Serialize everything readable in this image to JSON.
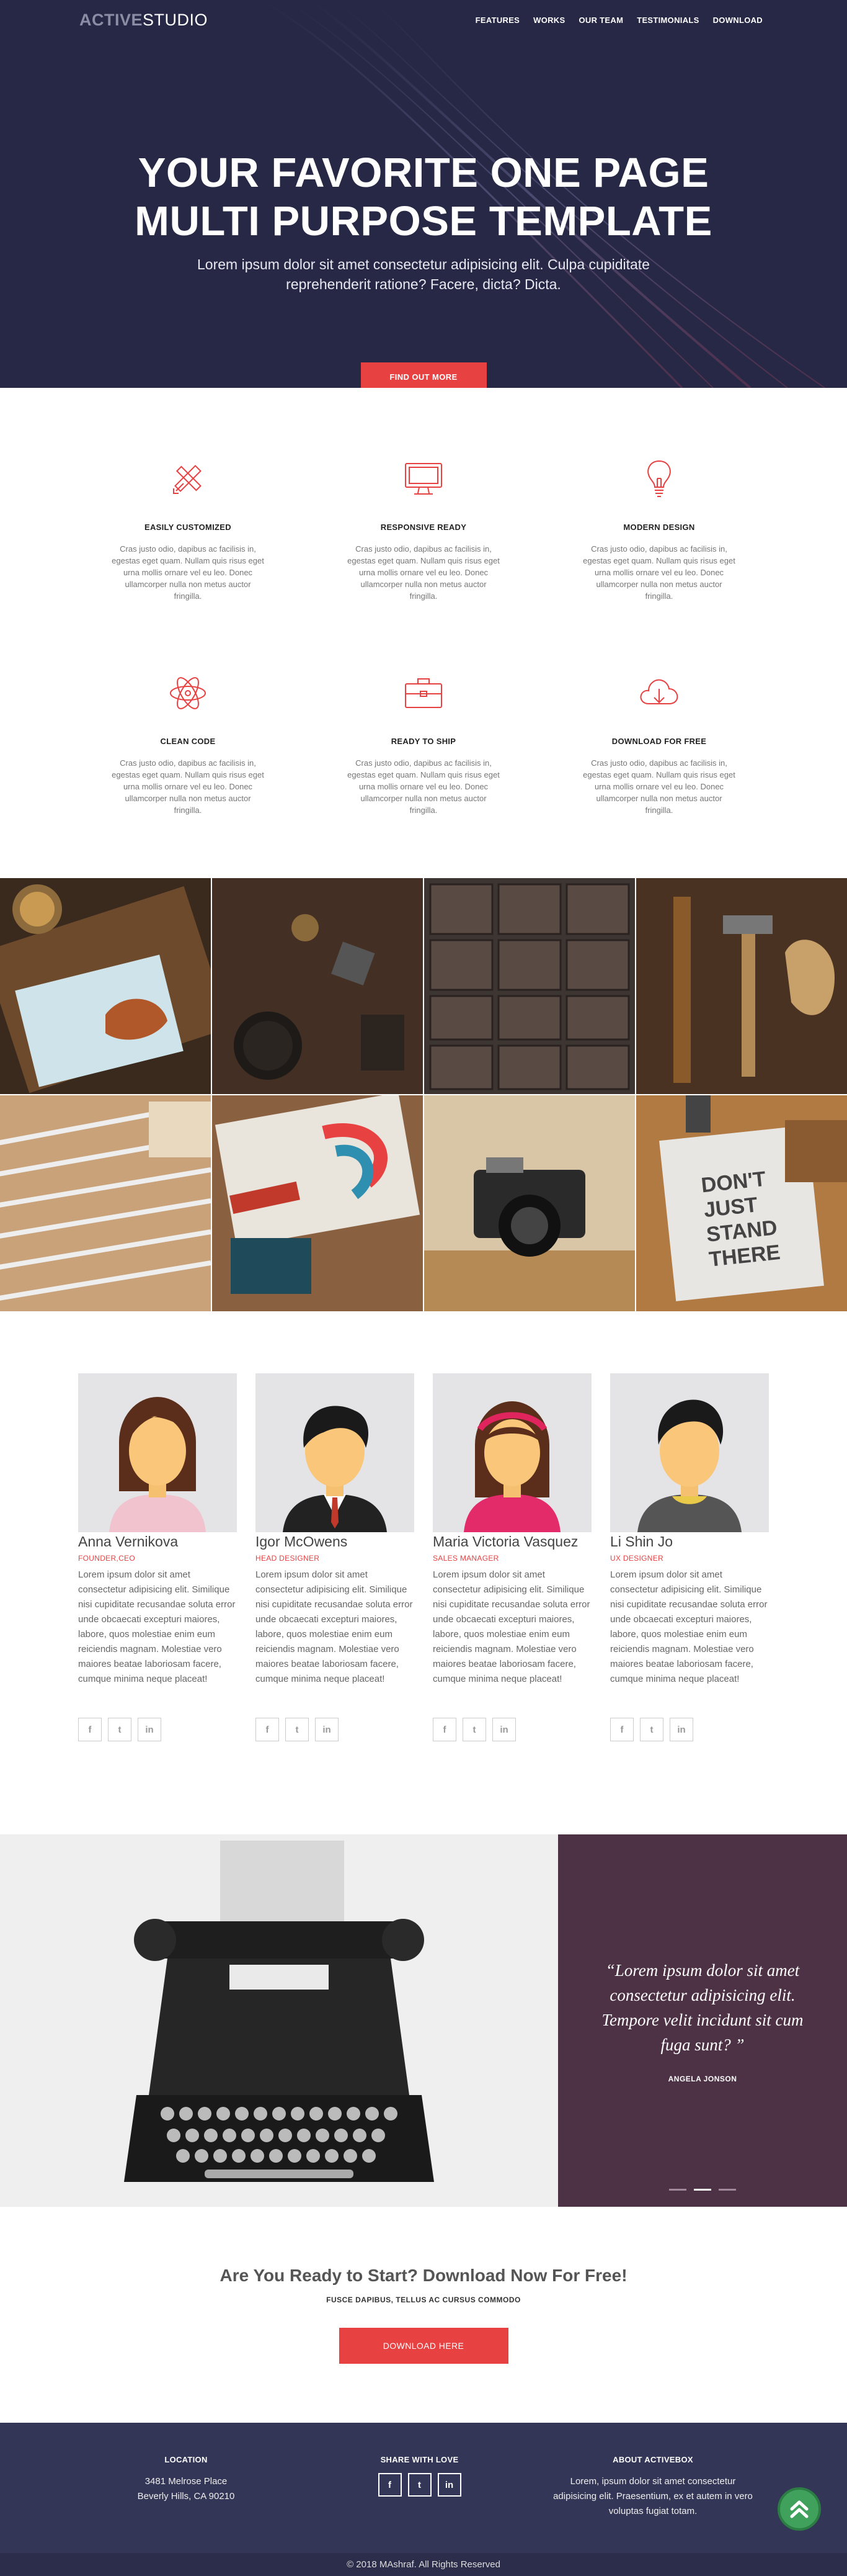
{
  "brand": {
    "part1": "ACTIVE",
    "part2": "STUDIO"
  },
  "nav": [
    "FEATURES",
    "WORKS",
    "OUR TEAM",
    "TESTIMONIALS",
    "DOWNLOAD"
  ],
  "hero": {
    "title_line1": "YOUR FAVORITE ONE PAGE",
    "title_line2": "MULTI PURPOSE TEMPLATE",
    "subtitle_line1": "Lorem ipsum dolor sit amet consectetur adipisicing elit. Culpa cupiditate",
    "subtitle_line2": "reprehenderit ratione? Facere, dicta? Dicta.",
    "button": "FIND OUT MORE"
  },
  "features": [
    {
      "icon": "pencil-ruler-icon",
      "title": "EASILY CUSTOMIZED",
      "text": "Cras justo odio, dapibus ac facilisis in, egestas eget quam. Nullam quis risus eget urna mollis ornare vel eu leo. Donec ullamcorper nulla non metus auctor fringilla."
    },
    {
      "icon": "monitor-icon",
      "title": "RESPONSIVE READY",
      "text": "Cras justo odio, dapibus ac facilisis in, egestas eget quam. Nullam quis risus eget urna mollis ornare vel eu leo. Donec ullamcorper nulla non metus auctor fringilla."
    },
    {
      "icon": "lightbulb-icon",
      "title": "MODERN DESIGN",
      "text": "Cras justo odio, dapibus ac facilisis in, egestas eget quam. Nullam quis risus eget urna mollis ornare vel eu leo. Donec ullamcorper nulla non metus auctor fringilla."
    },
    {
      "icon": "atom-icon",
      "title": "CLEAN CODE",
      "text": "Cras justo odio, dapibus ac facilisis in, egestas eget quam. Nullam quis risus eget urna mollis ornare vel eu leo. Donec ullamcorper nulla non metus auctor fringilla."
    },
    {
      "icon": "briefcase-icon",
      "title": "READY TO SHIP",
      "text": "Cras justo odio, dapibus ac facilisis in, egestas eget quam. Nullam quis risus eget urna mollis ornare vel eu leo. Donec ullamcorper nulla non metus auctor fringilla."
    },
    {
      "icon": "cloud-download-icon",
      "title": "DOWNLOAD FOR FREE",
      "text": "Cras justo odio, dapibus ac facilisis in, egestas eget quam. Nullam quis risus eget urna mollis ornare vel eu leo. Donec ullamcorper nulla non metus auctor fringilla."
    }
  ],
  "gallery": [
    "food-photo",
    "desk-tools-photo",
    "letterpress-photo",
    "tools-photo",
    "pencils-photo",
    "posters-photo",
    "camera-photo",
    "notebook-photo"
  ],
  "team": [
    {
      "name": "Anna Vernikova",
      "role": "FOUNDER,CEO",
      "avatar": "woman-avatar",
      "bio": "Lorem ipsum dolor sit amet consectetur adipisicing elit. Similique nisi cupiditate recusandae soluta error unde obcaecati excepturi maiores, labore, quos molestiae enim eum reiciendis magnam. Molestiae vero maiores beatae laboriosam facere, cumque minima neque placeat!"
    },
    {
      "name": "Igor McOwens",
      "role": "HEAD DESIGNER",
      "avatar": "man-suit-avatar",
      "bio": "Lorem ipsum dolor sit amet consectetur adipisicing elit. Similique nisi cupiditate recusandae soluta error unde obcaecati excepturi maiores, labore, quos molestiae enim eum reiciendis magnam. Molestiae vero maiores beatae laboriosam facere, cumque minima neque placeat!"
    },
    {
      "name": "Maria Victoria Vasquez",
      "role": "SALES MANAGER",
      "avatar": "woman-headband-avatar",
      "bio": "Lorem ipsum dolor sit amet consectetur adipisicing elit. Similique nisi cupiditate recusandae soluta error unde obcaecati excepturi maiores, labore, quos molestiae enim eum reiciendis magnam. Molestiae vero maiores beatae laboriosam facere, cumque minima neque placeat!"
    },
    {
      "name": "Li Shin Jo",
      "role": "UX DESIGNER",
      "avatar": "man-casual-avatar",
      "bio": "Lorem ipsum dolor sit amet consectetur adipisicing elit. Similique nisi cupiditate recusandae soluta error unde obcaecati excepturi maiores, labore, quos molestiae enim eum reiciendis magnam. Molestiae vero maiores beatae laboriosam facere, cumque minima neque placeat!"
    }
  ],
  "social_glyphs": {
    "facebook": "f",
    "twitter": "t",
    "linkedin": "in"
  },
  "testimonial": {
    "quote": "“Lorem ipsum dolor sit amet consectetur adipisicing elit. Tempore velit incidunt sit cum fuga sunt? ”",
    "author": "ANGELA JONSON"
  },
  "cta": {
    "title": "Are You Ready to Start? Download Now For Free!",
    "subtitle": "FUSCE DAPIBUS, TELLUS AC CURSUS COMMODO",
    "button": "DOWNLOAD HERE"
  },
  "footer": {
    "location_title": "LOCATION",
    "location_line1": "3481 Melrose Place",
    "location_line2": "Beverly Hills, CA 90210",
    "share_title": "SHARE WITH LOVE",
    "about_title": "ABOUT ACTIVEBOX",
    "about_text": "Lorem, ipsum dolor sit amet consectetur adipisicing elit. Praesentium, ex et autem in vero voluptas fugiat totam.",
    "copyright": "© 2018 MAshraf. All Rights Reserved"
  },
  "colors": {
    "hero_bg": "#272845",
    "accent": "#e84142",
    "quote_bg": "#4d3144",
    "footer_bg": "#333656",
    "top_button": "#3fa15b"
  }
}
